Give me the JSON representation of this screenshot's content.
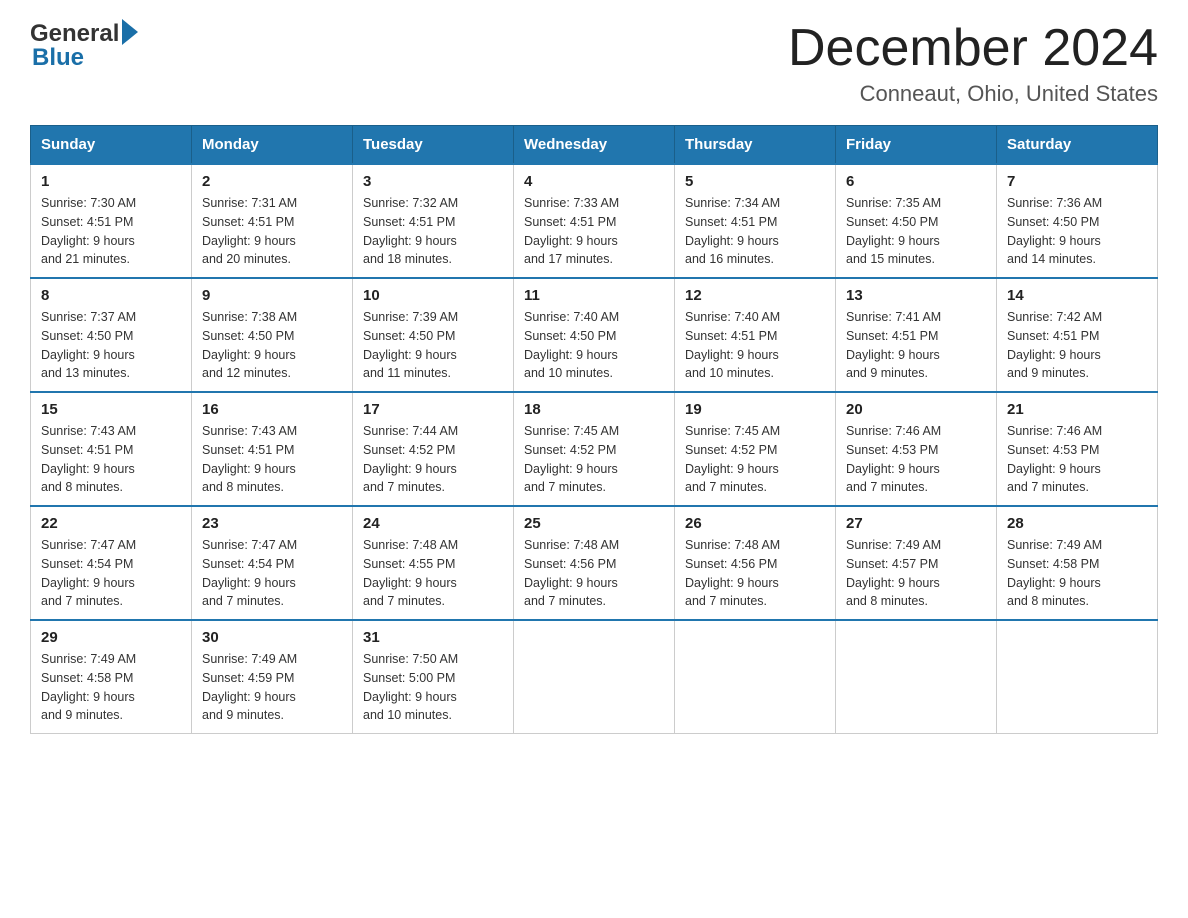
{
  "header": {
    "title": "December 2024",
    "subtitle": "Conneaut, Ohio, United States"
  },
  "logo": {
    "part1": "General",
    "part2": "Blue"
  },
  "days_of_week": [
    "Sunday",
    "Monday",
    "Tuesday",
    "Wednesday",
    "Thursday",
    "Friday",
    "Saturday"
  ],
  "weeks": [
    [
      {
        "day": "1",
        "sunrise": "7:30 AM",
        "sunset": "4:51 PM",
        "daylight": "9 hours and 21 minutes."
      },
      {
        "day": "2",
        "sunrise": "7:31 AM",
        "sunset": "4:51 PM",
        "daylight": "9 hours and 20 minutes."
      },
      {
        "day": "3",
        "sunrise": "7:32 AM",
        "sunset": "4:51 PM",
        "daylight": "9 hours and 18 minutes."
      },
      {
        "day": "4",
        "sunrise": "7:33 AM",
        "sunset": "4:51 PM",
        "daylight": "9 hours and 17 minutes."
      },
      {
        "day": "5",
        "sunrise": "7:34 AM",
        "sunset": "4:51 PM",
        "daylight": "9 hours and 16 minutes."
      },
      {
        "day": "6",
        "sunrise": "7:35 AM",
        "sunset": "4:50 PM",
        "daylight": "9 hours and 15 minutes."
      },
      {
        "day": "7",
        "sunrise": "7:36 AM",
        "sunset": "4:50 PM",
        "daylight": "9 hours and 14 minutes."
      }
    ],
    [
      {
        "day": "8",
        "sunrise": "7:37 AM",
        "sunset": "4:50 PM",
        "daylight": "9 hours and 13 minutes."
      },
      {
        "day": "9",
        "sunrise": "7:38 AM",
        "sunset": "4:50 PM",
        "daylight": "9 hours and 12 minutes."
      },
      {
        "day": "10",
        "sunrise": "7:39 AM",
        "sunset": "4:50 PM",
        "daylight": "9 hours and 11 minutes."
      },
      {
        "day": "11",
        "sunrise": "7:40 AM",
        "sunset": "4:50 PM",
        "daylight": "9 hours and 10 minutes."
      },
      {
        "day": "12",
        "sunrise": "7:40 AM",
        "sunset": "4:51 PM",
        "daylight": "9 hours and 10 minutes."
      },
      {
        "day": "13",
        "sunrise": "7:41 AM",
        "sunset": "4:51 PM",
        "daylight": "9 hours and 9 minutes."
      },
      {
        "day": "14",
        "sunrise": "7:42 AM",
        "sunset": "4:51 PM",
        "daylight": "9 hours and 9 minutes."
      }
    ],
    [
      {
        "day": "15",
        "sunrise": "7:43 AM",
        "sunset": "4:51 PM",
        "daylight": "9 hours and 8 minutes."
      },
      {
        "day": "16",
        "sunrise": "7:43 AM",
        "sunset": "4:51 PM",
        "daylight": "9 hours and 8 minutes."
      },
      {
        "day": "17",
        "sunrise": "7:44 AM",
        "sunset": "4:52 PM",
        "daylight": "9 hours and 7 minutes."
      },
      {
        "day": "18",
        "sunrise": "7:45 AM",
        "sunset": "4:52 PM",
        "daylight": "9 hours and 7 minutes."
      },
      {
        "day": "19",
        "sunrise": "7:45 AM",
        "sunset": "4:52 PM",
        "daylight": "9 hours and 7 minutes."
      },
      {
        "day": "20",
        "sunrise": "7:46 AM",
        "sunset": "4:53 PM",
        "daylight": "9 hours and 7 minutes."
      },
      {
        "day": "21",
        "sunrise": "7:46 AM",
        "sunset": "4:53 PM",
        "daylight": "9 hours and 7 minutes."
      }
    ],
    [
      {
        "day": "22",
        "sunrise": "7:47 AM",
        "sunset": "4:54 PM",
        "daylight": "9 hours and 7 minutes."
      },
      {
        "day": "23",
        "sunrise": "7:47 AM",
        "sunset": "4:54 PM",
        "daylight": "9 hours and 7 minutes."
      },
      {
        "day": "24",
        "sunrise": "7:48 AM",
        "sunset": "4:55 PM",
        "daylight": "9 hours and 7 minutes."
      },
      {
        "day": "25",
        "sunrise": "7:48 AM",
        "sunset": "4:56 PM",
        "daylight": "9 hours and 7 minutes."
      },
      {
        "day": "26",
        "sunrise": "7:48 AM",
        "sunset": "4:56 PM",
        "daylight": "9 hours and 7 minutes."
      },
      {
        "day": "27",
        "sunrise": "7:49 AM",
        "sunset": "4:57 PM",
        "daylight": "9 hours and 8 minutes."
      },
      {
        "day": "28",
        "sunrise": "7:49 AM",
        "sunset": "4:58 PM",
        "daylight": "9 hours and 8 minutes."
      }
    ],
    [
      {
        "day": "29",
        "sunrise": "7:49 AM",
        "sunset": "4:58 PM",
        "daylight": "9 hours and 9 minutes."
      },
      {
        "day": "30",
        "sunrise": "7:49 AM",
        "sunset": "4:59 PM",
        "daylight": "9 hours and 9 minutes."
      },
      {
        "day": "31",
        "sunrise": "7:50 AM",
        "sunset": "5:00 PM",
        "daylight": "9 hours and 10 minutes."
      },
      null,
      null,
      null,
      null
    ]
  ],
  "labels": {
    "sunrise": "Sunrise:",
    "sunset": "Sunset:",
    "daylight": "Daylight:"
  }
}
